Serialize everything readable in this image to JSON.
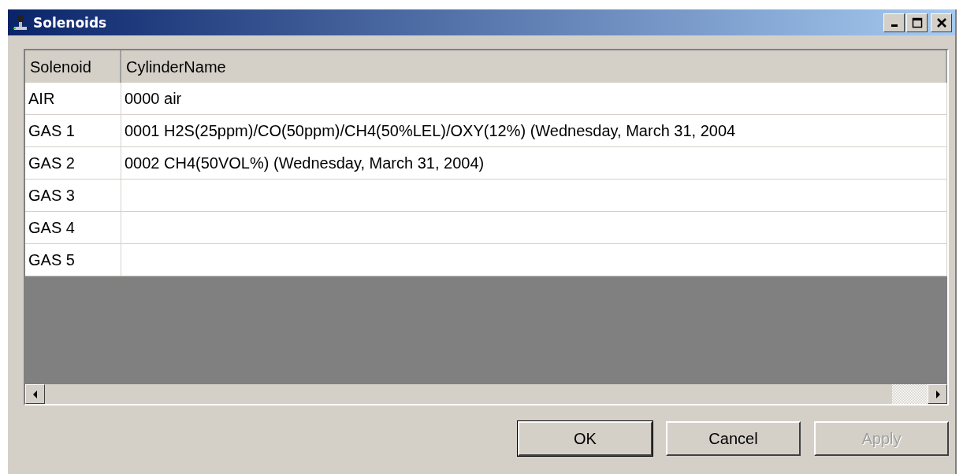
{
  "window": {
    "title": "Solenoids"
  },
  "table": {
    "columns": [
      "Solenoid",
      "CylinderName"
    ],
    "rows": [
      {
        "cells": [
          "AIR",
          "0000 air"
        ]
      },
      {
        "cells": [
          "GAS 1",
          "0001 H2S(25ppm)/CO(50ppm)/CH4(50%LEL)/OXY(12%) (Wednesday, March 31, 2004"
        ]
      },
      {
        "cells": [
          "GAS 2",
          "0002 CH4(50VOL%) (Wednesday, March 31, 2004)"
        ]
      },
      {
        "cells": [
          "GAS 3",
          ""
        ]
      },
      {
        "cells": [
          "GAS 4",
          ""
        ]
      },
      {
        "cells": [
          "GAS 5",
          ""
        ]
      }
    ]
  },
  "buttons": [
    {
      "label": "OK",
      "default": true,
      "disabled": false
    },
    {
      "label": "Cancel",
      "default": false,
      "disabled": false
    },
    {
      "label": "Apply",
      "default": false,
      "disabled": true
    }
  ]
}
